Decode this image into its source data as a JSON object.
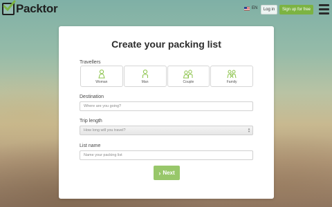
{
  "header": {
    "logo_text": "Packtor",
    "language": "EN",
    "login_label": "Log in",
    "signup_label": "Sign up for free"
  },
  "form": {
    "title": "Create your packing list",
    "travellers_label": "Travellers",
    "travellers": [
      {
        "label": "Woman",
        "icon": "woman-icon"
      },
      {
        "label": "Man",
        "icon": "man-icon"
      },
      {
        "label": "Couple",
        "icon": "couple-icon"
      },
      {
        "label": "Family",
        "icon": "family-icon"
      }
    ],
    "destination_label": "Destination",
    "destination_placeholder": "Where are you going?",
    "trip_length_label": "Trip length",
    "trip_length_placeholder": "How long will you travel?",
    "list_name_label": "List name",
    "list_name_placeholder": "Name your packing list",
    "next_label": "Next"
  },
  "colors": {
    "accent": "#7cb342",
    "next_button": "#98c76a",
    "icon_green": "#8bc34a"
  }
}
